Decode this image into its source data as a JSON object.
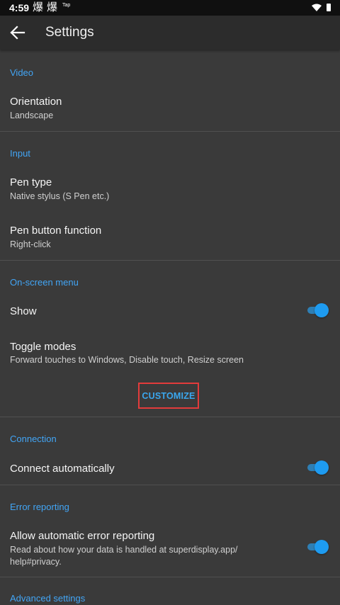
{
  "status_bar": {
    "time": "4:59",
    "notif1": "爆",
    "notif2": "爆",
    "tiny_label": "Tap",
    "icons": [
      "wifi-icon",
      "battery-icon"
    ]
  },
  "app_bar": {
    "back_icon": "arrow-left-icon",
    "title": "Settings"
  },
  "sections": {
    "video": {
      "header": "Video",
      "orientation": {
        "title": "Orientation",
        "value": "Landscape"
      }
    },
    "input": {
      "header": "Input",
      "pen_type": {
        "title": "Pen type",
        "value": "Native stylus (S Pen etc.)"
      },
      "pen_button": {
        "title": "Pen button function",
        "value": "Right-click"
      }
    },
    "on_screen_menu": {
      "header": "On-screen menu",
      "show": {
        "title": "Show",
        "enabled": true
      },
      "toggle_modes": {
        "title": "Toggle modes",
        "value": "Forward touches to Windows, Disable touch, Resize screen"
      },
      "customize_label": "CUSTOMIZE"
    },
    "connection": {
      "header": "Connection",
      "connect_auto": {
        "title": "Connect automatically",
        "enabled": true
      }
    },
    "error_reporting": {
      "header": "Error reporting",
      "allow": {
        "title": "Allow automatic error reporting",
        "desc_line1": "Read about how your data is handled at superdisplay.app/",
        "desc_line2": "help#privacy.",
        "enabled": true
      }
    },
    "advanced": {
      "header": "Advanced settings"
    }
  },
  "colors": {
    "accent": "#42a5f5",
    "background": "#3a3a3a",
    "app_bar": "#2c2c2c",
    "highlight_border": "#e23b3b"
  }
}
